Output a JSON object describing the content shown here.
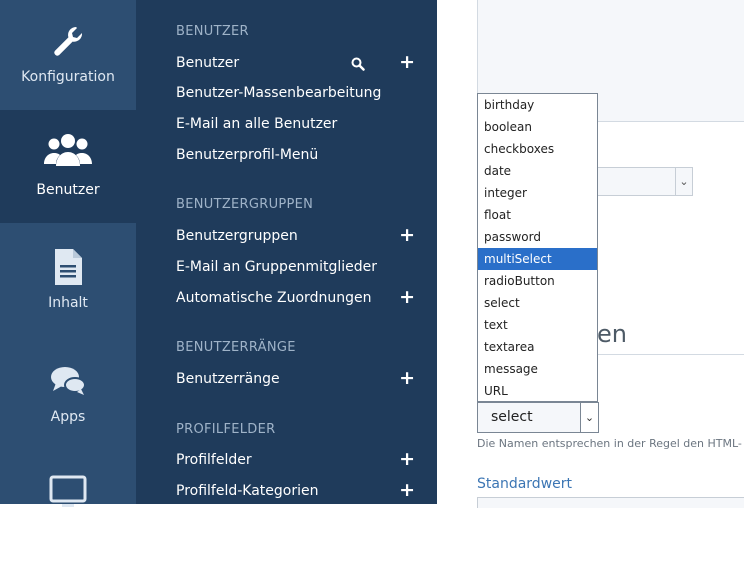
{
  "rail": {
    "items": [
      {
        "label": "Konfiguration",
        "icon": "wrench-icon"
      },
      {
        "label": "Benutzer",
        "icon": "users-icon"
      },
      {
        "label": "Inhalt",
        "icon": "document-icon"
      },
      {
        "label": "Apps",
        "icon": "chat-icon"
      },
      {
        "label": "",
        "icon": "monitor-icon"
      }
    ]
  },
  "subnav": {
    "sections": [
      {
        "heading": "BENUTZER",
        "items": [
          "Benutzer",
          "Benutzer-Massenbearbeitung",
          "E-Mail an alle Benutzer",
          "Benutzerprofil-Menü"
        ]
      },
      {
        "heading": "BENUTZERGRUPPEN",
        "items": [
          "Benutzergruppen",
          "E-Mail an Gruppenmitglieder",
          "Automatische Zuordnungen"
        ]
      },
      {
        "heading": "BENUTZERRÄNGE",
        "items": [
          "Benutzerränge"
        ]
      },
      {
        "heading": "PROFILFELDER",
        "items": [
          "Profilfelder",
          "Profilfeld-Kategorien"
        ]
      }
    ],
    "plus": "+"
  },
  "content": {
    "section_title_fragment": "en",
    "type_select_value": "select",
    "hint_text": "Die Namen entsprechen in der Regel den HTML-",
    "std_label": "Standardwert"
  },
  "dropdown": {
    "options": [
      "birthday",
      "boolean",
      "checkboxes",
      "date",
      "integer",
      "float",
      "password",
      "multiSelect",
      "radioButton",
      "select",
      "text",
      "textarea",
      "message",
      "URL"
    ],
    "selected": "multiSelect"
  },
  "colors": {
    "rail_bg": "#2d4e72",
    "subnav_bg": "#1f3b5b",
    "selected_option": "#2a6fc9",
    "link_blue": "#3c76b4"
  }
}
